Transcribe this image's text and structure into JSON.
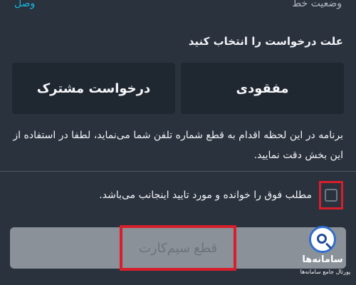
{
  "header": {
    "status_right": "وضعیت خط",
    "status_left": "وصل"
  },
  "form": {
    "reason_title": "علت درخواست را انتخاب کنید",
    "reasons": [
      {
        "label": "مفقودی"
      },
      {
        "label": "درخواست مشترک"
      }
    ],
    "notice": "برنامه در این لحظه اقدام به قطع شماره تلفن شما می‌نماید، لطفا در استفاده از این بخش دقت نمایید.",
    "confirmation_label": "مطلب فوق را خوانده و مورد تایید اینجانب می‌باشد.",
    "submit_label": "قطع سیم‌کارت"
  },
  "watermark": {
    "name": "سامانه‌ها",
    "subtitle": "پورتال جامع سامانه‌ها"
  },
  "colors": {
    "background": "#2a323d",
    "card": "#1f2731",
    "highlight": "#d61f2b",
    "button_disabled": "#8b9199",
    "accent": "#18b5dd"
  }
}
